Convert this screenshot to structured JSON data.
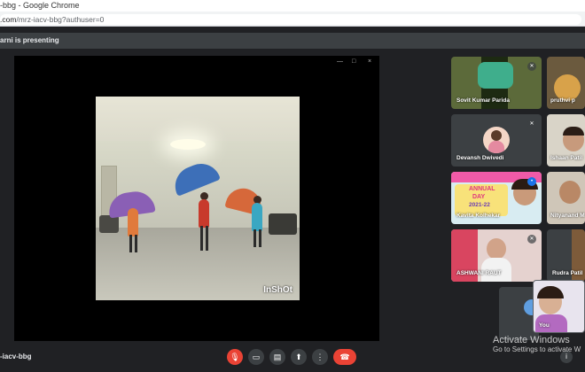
{
  "browser": {
    "title": "-bbg - Google Chrome",
    "url_host": ".com",
    "url_path": "/mrz-iacv-bbg?authuser=0"
  },
  "presenting": {
    "text": "arni is presenting"
  },
  "stage": {
    "window_controls": [
      "—",
      "□",
      "×"
    ],
    "video_watermark": "InShOt"
  },
  "participants": [
    {
      "name": "Sovit Kumar Parida",
      "muted": true
    },
    {
      "name": "pruthvi p"
    },
    {
      "name": "Devansh Dwivedi",
      "muted": true
    },
    {
      "name": "Ishaan Patil"
    },
    {
      "name": "Kavita Kolhekar"
    },
    {
      "name": "Nityanand M"
    },
    {
      "name": "ASHWANI RAUT",
      "muted": true
    },
    {
      "name": "Rudra Patil"
    },
    {
      "name": "You"
    }
  ],
  "annual_day_banner": {
    "line1": "ANNUAL",
    "line2": "DAY",
    "line3": "2021-22"
  },
  "meeting": {
    "code": "-iacv-bbg"
  },
  "controls": {
    "mic_icon": "mic-off-icon",
    "camera_icon": "camera-icon",
    "captions_icon": "captions-icon",
    "present_icon": "present-icon",
    "more_icon": "more-vert-icon",
    "hangup_icon": "call-end-icon"
  },
  "windows_watermark": {
    "line1": "Activate Windows",
    "line2": "Go to Settings to activate W"
  },
  "colors": {
    "background": "#202124",
    "tile": "#3c4043",
    "danger": "#ea4335"
  }
}
